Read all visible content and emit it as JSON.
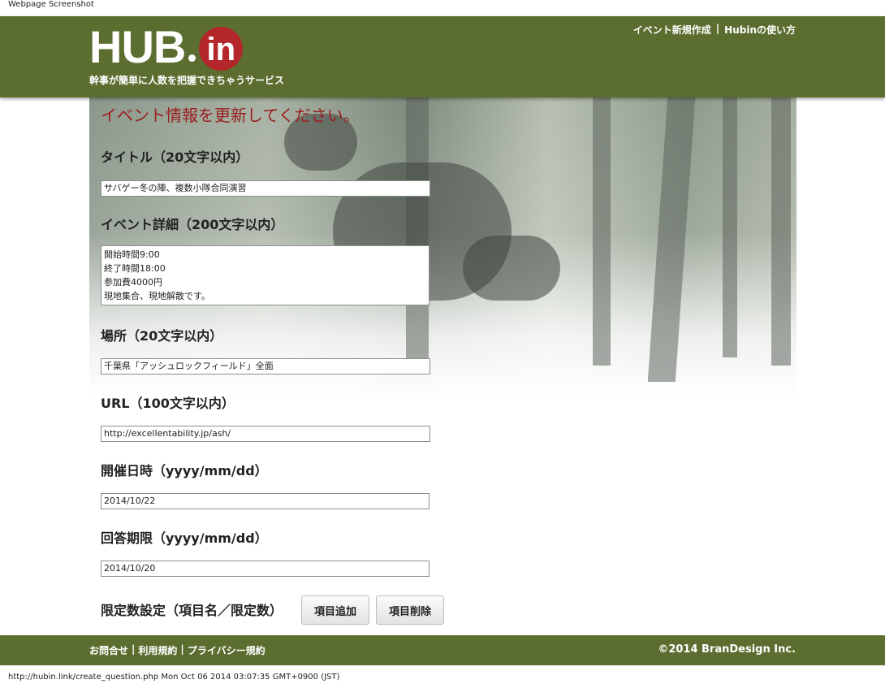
{
  "caption": "Webpage Screenshot",
  "header": {
    "logo_main": "HUB",
    "logo_sub": "in",
    "tagline": "幹事が簡単に人数を把握できちゃうサービス",
    "nav": [
      {
        "label": "イベント新規作成"
      },
      {
        "label": "Hubinの使い方"
      }
    ],
    "nav_separator": "|"
  },
  "form": {
    "title": "イベント情報を更新してください。",
    "title_label": "タイトル（20文字以内）",
    "title_value": "サバゲー冬の陣、複数小隊合同演習",
    "detail_label": "イベント詳細（200文字以内）",
    "detail_lines": [
      "開始時間9:00",
      "終了時間18:00",
      "参加費4000円",
      "現地集合、現地解散です。"
    ],
    "place_label": "場所（20文字以内）",
    "place_value": "千葉県「アッシュロックフィールド」全面",
    "url_label": "URL（100文字以内）",
    "url_value": "http://excellentability.jp/ash/",
    "date_label": "開催日時（yyyy/mm/dd）",
    "date_value": "2014/10/22",
    "deadline_label": "回答期限（yyyy/mm/dd）",
    "deadline_value": "2014/10/20",
    "limit_label": "限定数設定（項目名／限定数）",
    "add_button": "項目追加",
    "delete_button": "項目削除"
  },
  "footer": {
    "links": [
      {
        "label": "お問合せ"
      },
      {
        "label": "利用規約"
      },
      {
        "label": "プライバシー規約"
      }
    ],
    "separator": "|",
    "copyright": "©2014 BranDesign Inc."
  },
  "statusbar": "http://hubin.link/create_question.php Mon Oct 06 2014 03:07:35 GMT+0900 (JST)",
  "colors": {
    "header_bg": "#5b6e30",
    "logo_circle": "#b3262a",
    "title_red": "#9a1d1d"
  }
}
